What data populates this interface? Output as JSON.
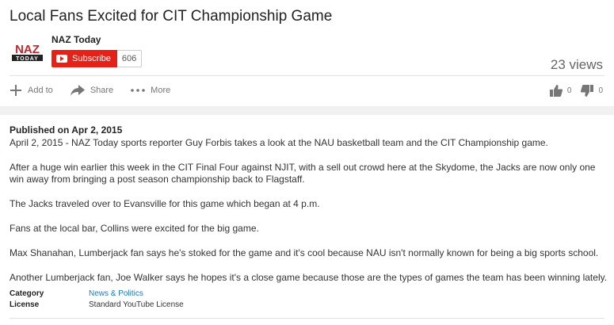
{
  "video": {
    "title": "Local Fans Excited for CIT Championship Game",
    "views": "23 views"
  },
  "channel": {
    "name": "NAZ Today",
    "logo_text_top": "NAZ",
    "logo_text_bottom": "TODAY",
    "subscribe_label": "Subscribe",
    "subscriber_count": "606",
    "brand_color": "#e62117"
  },
  "actions": {
    "add_to": "Add to",
    "share": "Share",
    "more": "More",
    "likes": "0",
    "dislikes": "0",
    "icons": [
      "plus-icon",
      "share-arrow-icon",
      "more-dots-icon",
      "thumbs-up-icon",
      "thumbs-down-icon"
    ]
  },
  "description": {
    "published": "Published on Apr 2, 2015",
    "paragraphs": [
      "April 2, 2015 - NAZ Today sports reporter Guy Forbis takes a look at the NAU basketball team and the CIT Championship game.",
      "After a huge win earlier this week in the CIT Final Four against NJIT, with a sell out crowd here at the Skydome, the Jacks are now only one win away from bringing a post season championship back to Flagstaff.",
      "The Jacks traveled over to Evansville for this game which began at 4 p.m.",
      "Fans at the local bar, Collins were excited for the big game.",
      "Max Shanahan, Lumberjack fan says he's stoked for the game and it's cool because NAU isn't normally known for being a big sports school.",
      "Another Lumberjack fan, Joe Walker says he hopes it's a close game because those are the types of games the team has been winning lately."
    ]
  },
  "meta": {
    "category_label": "Category",
    "category_value": "News & Politics",
    "license_label": "License",
    "license_value": "Standard YouTube License"
  }
}
